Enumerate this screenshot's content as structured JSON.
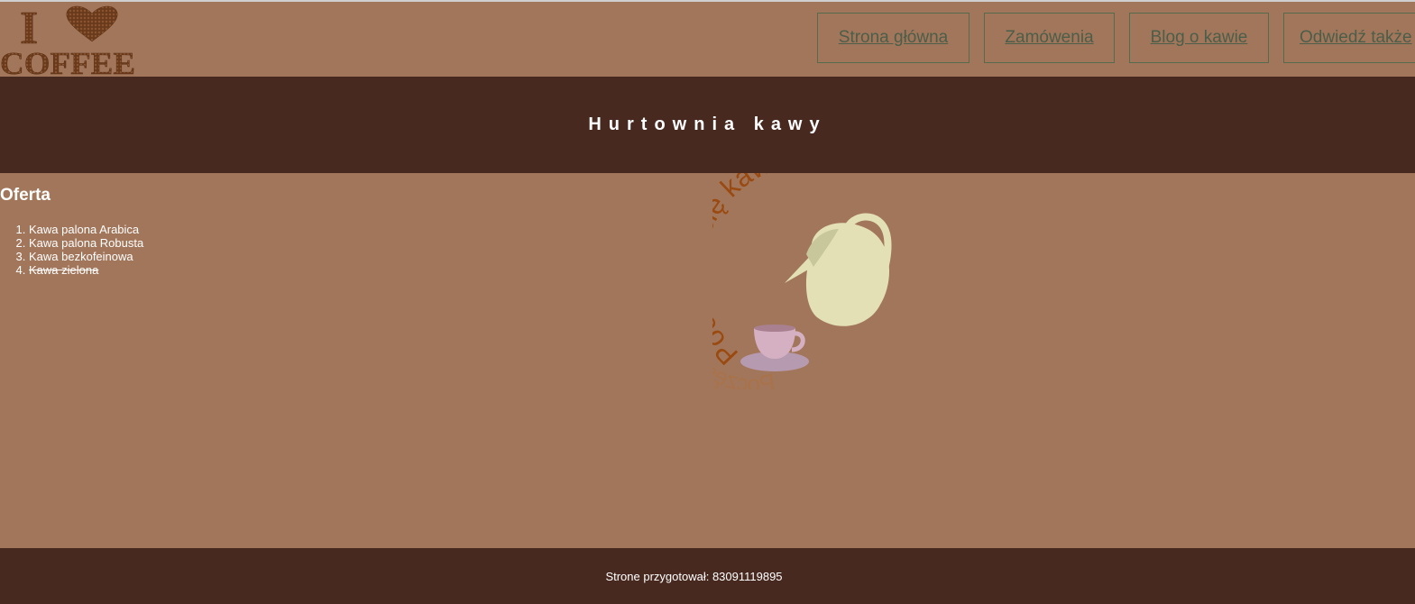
{
  "header": {
    "logo": {
      "text_top": "I",
      "text_bottom": "COFFEE",
      "icon": "heart-icon"
    },
    "nav": [
      {
        "label": "Strona główna "
      },
      {
        "label": "Zamówenia "
      },
      {
        "label": "Blog o kawie "
      },
      {
        "label": "Odwiedź także"
      }
    ]
  },
  "banner": {
    "title": "Hurtownia kawy"
  },
  "main": {
    "section_title": "Oferta",
    "offer_items": [
      {
        "label": "Kawa palona Arabica",
        "struck": false
      },
      {
        "label": "Kawa palona Robusta",
        "struck": false
      },
      {
        "label": "Kawa bezkofeinowa",
        "struck": false
      },
      {
        "label": "Kawa zielona",
        "struck": true
      }
    ],
    "illustration": {
      "arc_text": "Poczęstuj się kawą",
      "mirror_text": "Poczęstuj się kawą",
      "icons": [
        "teapot-icon",
        "coffee-cup-icon"
      ]
    }
  },
  "footer": {
    "text": "Strone przygotował: 83091119895"
  },
  "colors": {
    "background": "#A2765A",
    "dark_band": "#482920",
    "nav_text": "#4B5E4A",
    "nav_border": "#556B4E",
    "arc_text": "#9A4A10",
    "teapot": "#E3E0B6",
    "cup": "#C9A3B6"
  }
}
